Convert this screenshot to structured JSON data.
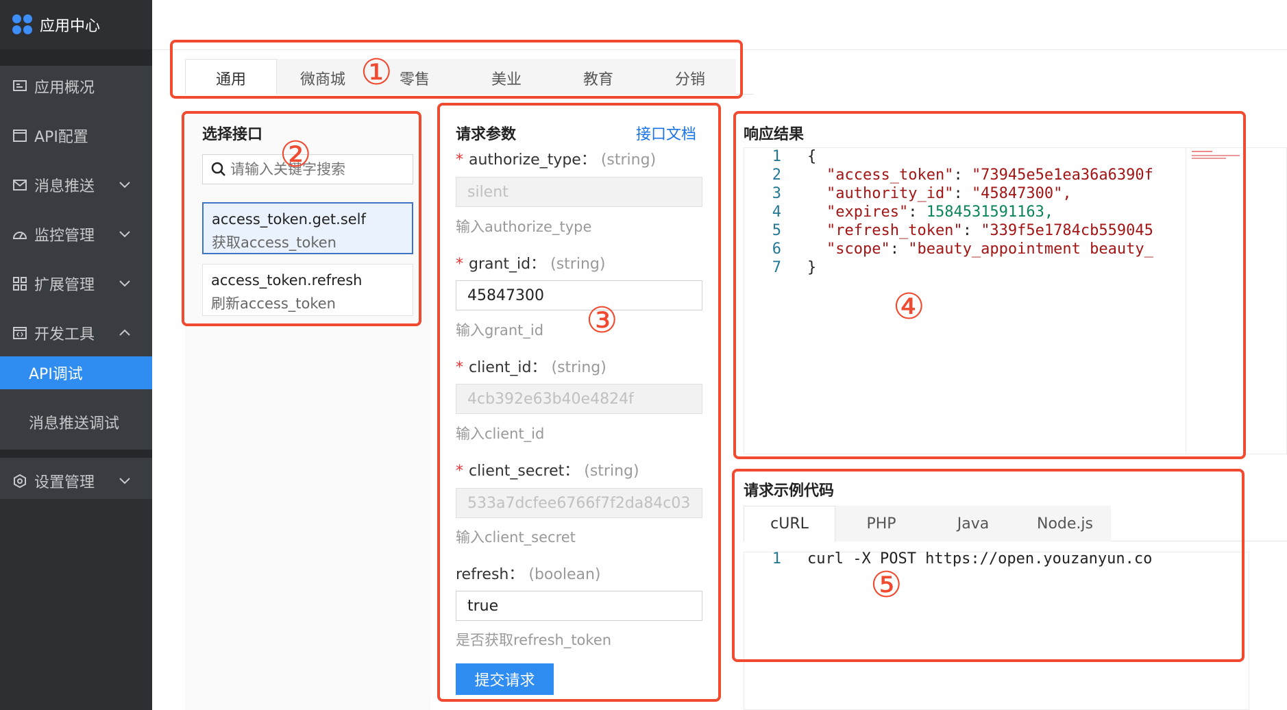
{
  "sidebar": {
    "brand": "应用中心",
    "items": [
      {
        "label": "应用概况",
        "icon": "dashboard-icon"
      },
      {
        "label": "API配置",
        "icon": "window-icon"
      },
      {
        "label": "消息推送",
        "icon": "mail-icon",
        "expandable": true
      },
      {
        "label": "监控管理",
        "icon": "gauge-icon",
        "expandable": true
      },
      {
        "label": "扩展管理",
        "icon": "grid-icon",
        "expandable": true
      },
      {
        "label": "开发工具",
        "icon": "code-window-icon",
        "expanded": true
      }
    ],
    "subitems": [
      {
        "label": "API调试",
        "active": true
      },
      {
        "label": "消息推送调试",
        "active": false
      }
    ],
    "settings": {
      "label": "设置管理",
      "icon": "settings-icon"
    }
  },
  "tabs": [
    "通用",
    "微商城",
    "零售",
    "美业",
    "教育",
    "分销"
  ],
  "select_api": {
    "title": "选择接口",
    "search_placeholder": "请输入关键字搜索",
    "items": [
      {
        "name": "access_token.get.self",
        "desc": "获取access_token"
      },
      {
        "name": "access_token.refresh",
        "desc": "刷新access_token"
      }
    ]
  },
  "request_params": {
    "title": "请求参数",
    "doc_link": "接口文档",
    "params": [
      {
        "name": "authorize_type：",
        "type": "(string)",
        "value": "silent",
        "hint": "输入authorize_type"
      },
      {
        "name": "grant_id：",
        "type": "(string)",
        "value": "45847300",
        "hint": "输入grant_id"
      },
      {
        "name": "client_id：",
        "type": "(string)",
        "value": "4cb392e63b40e4824f",
        "hint": "输入client_id"
      },
      {
        "name": "client_secret：",
        "type": "(string)",
        "value": "533a7dcfee6766f7f2da84c03",
        "hint": "输入client_secret"
      },
      {
        "name": "refresh：",
        "type": "(boolean)",
        "value": "true",
        "hint": "是否获取refresh_token"
      }
    ],
    "submit_label": "提交请求"
  },
  "response": {
    "title": "响应结果",
    "line_numbers": [
      "1",
      "2",
      "3",
      "4",
      "5",
      "6",
      "7"
    ],
    "lines": [
      {
        "text": "{"
      },
      {
        "key": "\"access_token\"",
        "value": "\"73945e5e1ea36a6390f"
      },
      {
        "key": "\"authority_id\"",
        "value": "\"45847300\","
      },
      {
        "key": "\"expires\"",
        "value": "1584531591163,"
      },
      {
        "key": "\"refresh_token\"",
        "value": "\"339f5e1784cb559045"
      },
      {
        "key": "\"scope\"",
        "value": "\"beauty_appointment beauty_"
      },
      {
        "text": "}"
      }
    ]
  },
  "sample_code": {
    "title": "请求示例代码",
    "tabs": [
      "cURL",
      "PHP",
      "Java",
      "Node.js"
    ],
    "line_number": "1",
    "line": "curl -X POST https://open.youzanyun.co"
  },
  "annotations": [
    "①",
    "②",
    "③",
    "④",
    "⑤"
  ],
  "colors": {
    "sidebar": "#2d2f33",
    "active": "#2f8cf0",
    "annotation": "#f04a30",
    "link": "#1a73e8"
  }
}
